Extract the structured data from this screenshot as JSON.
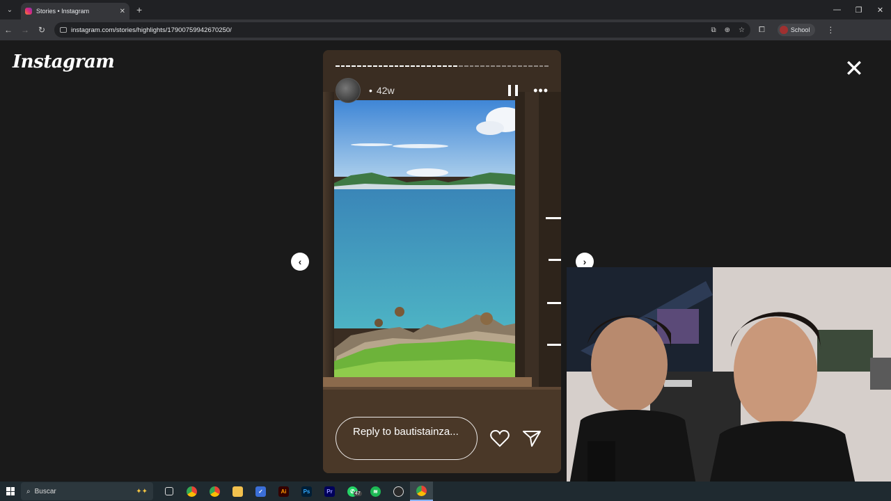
{
  "browser": {
    "tab_title": "Stories • Instagram",
    "url": "instagram.com/stories/highlights/17900759942670250/",
    "profile_label": "School"
  },
  "page": {
    "logo_text": "Instagram"
  },
  "story": {
    "time_ago": "42w",
    "dot": "•",
    "reply_placeholder": "Reply to bautistainza...",
    "progress_total": 40,
    "progress_done": 23
  },
  "taskbar": {
    "search_placeholder": "Buscar",
    "whatsapp_badge": "47"
  },
  "icons": {
    "close": "close-icon",
    "pause": "pause-icon",
    "more": "more-options-icon",
    "heart": "heart-icon",
    "send": "send-icon",
    "prev": "chevron-left-icon",
    "next": "chevron-right-icon"
  },
  "colors": {
    "page_bg": "#1a1a1a",
    "taskbar_bg": "#1f2a30",
    "browser_toolbar": "#35363a"
  }
}
